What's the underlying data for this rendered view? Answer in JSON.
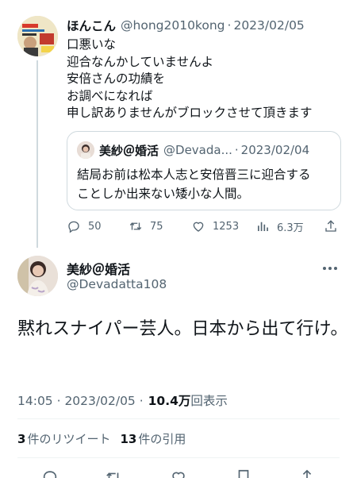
{
  "reply_tweet": {
    "name": "ほんこん",
    "handle": "@hong2010kong",
    "dot": "·",
    "date": "2023/02/05",
    "lines": [
      "口悪いな",
      "迎合なんかしていませんよ",
      "安倍さんの功績を",
      "お調べになれば",
      "申し訳ありませんがブロックさせて頂きます"
    ],
    "avatar_icon": "book-cover-avatar",
    "quote": {
      "name": "美紗＠婚活",
      "handle": "@Devada...",
      "dot": "·",
      "date": "2023/02/04",
      "lines": [
        "結局お前は松本人志と安倍晋三に迎合する",
        "ことしか出来ない矮小な人間。"
      ]
    },
    "actions": {
      "reply_count": "50",
      "retweet_count": "75",
      "like_count": "1253",
      "views_count": "6.3万"
    }
  },
  "main_tweet": {
    "name": "美紗＠婚活",
    "handle": "@Devadatta108",
    "text": "黙れスナイパー芸人。日本から出て行け。",
    "time": "14:05 · 2023/02/05 ·",
    "views_number": "10.4万",
    "views_suffix": "回表示",
    "retweet_count": "3",
    "retweet_label": "件のリツイート",
    "quote_count": "13",
    "quote_label": "件の引用"
  },
  "colors": {
    "text": "#0f1419",
    "secondary": "#536471",
    "border": "#cfd9de"
  }
}
